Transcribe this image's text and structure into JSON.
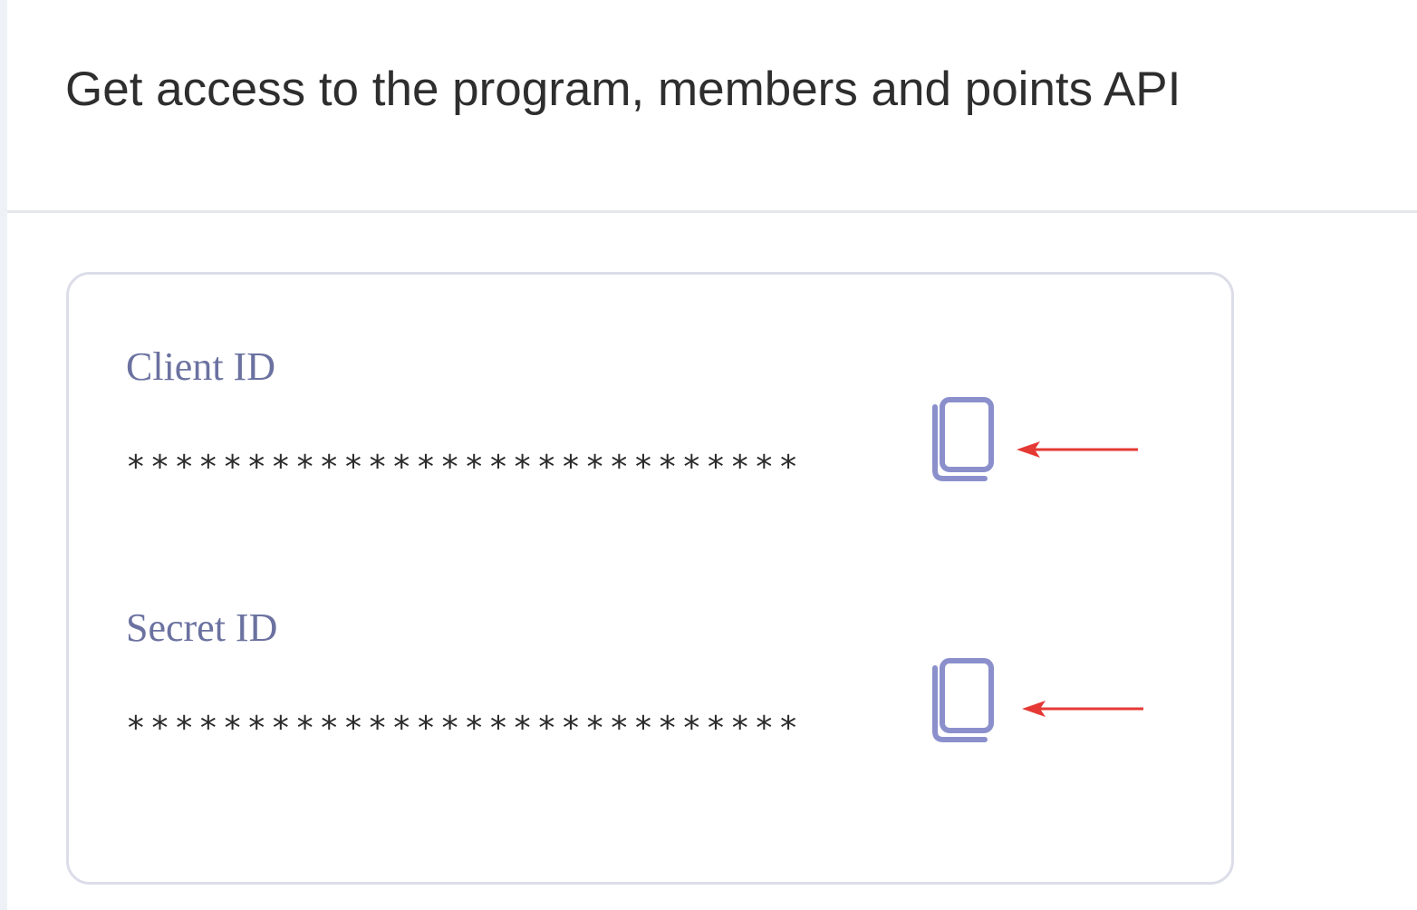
{
  "header": {
    "title": "Get access to the program, members and points API"
  },
  "credentials": {
    "client": {
      "label": "Client ID",
      "value": "****************************"
    },
    "secret": {
      "label": "Secret ID",
      "value": "****************************"
    }
  },
  "icons": {
    "copy": "copy-icon",
    "annotation_arrow": "left-arrow-icon"
  },
  "colors": {
    "label": "#6b72a0",
    "copy_icon": "#8b90cc",
    "annotation_arrow": "#e53935",
    "card_border": "#dcdde9"
  }
}
